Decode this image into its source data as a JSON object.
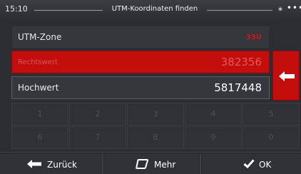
{
  "status": {
    "time": "15:10",
    "title": "UTM-Koordinaten finden",
    "icons": "⁎ •••"
  },
  "fields": {
    "zone": {
      "label": "UTM-Zone",
      "value": "33U"
    },
    "easting": {
      "label": "Rechtswert",
      "value": "382356"
    },
    "northing": {
      "label": "Hochwert",
      "value": "5817448"
    }
  },
  "keypad": {
    "row1": [
      "1",
      "2",
      "3",
      "4",
      "5"
    ],
    "row2": [
      "6",
      "7",
      "8",
      "9",
      "0"
    ]
  },
  "bottom": {
    "back_label": "Zurück",
    "more_label": "Mehr",
    "ok_label": "OK"
  },
  "colors": {
    "accent": "#c40d0d",
    "background": "#2a2d31"
  },
  "icons": {
    "back": "arrow-left-icon",
    "more": "rounded-square-icon",
    "ok": "checkmark-icon",
    "backspace": "backspace-arrow-icon"
  }
}
